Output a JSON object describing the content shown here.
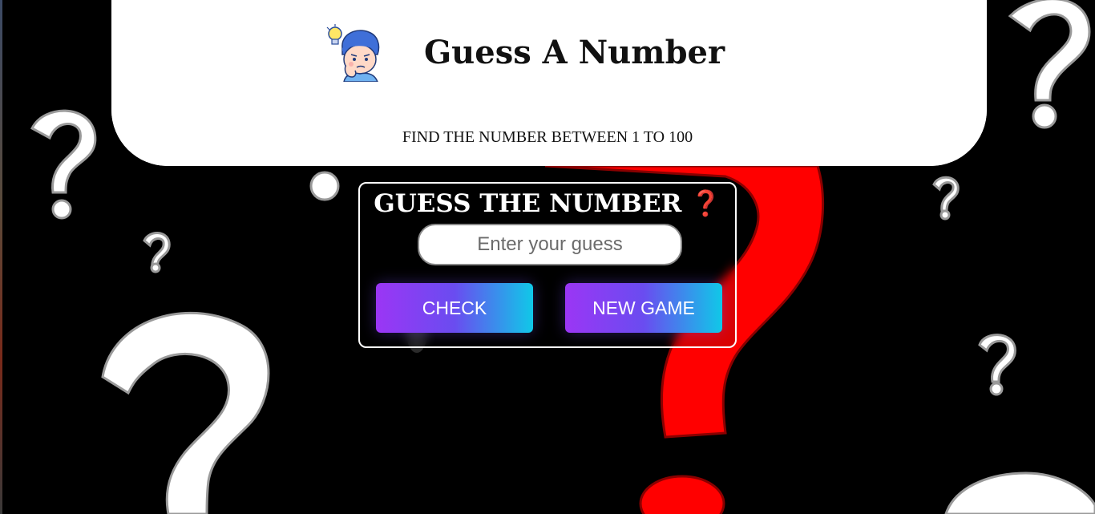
{
  "header": {
    "title": "Guess A Number",
    "subtitle": "FIND THE NUMBER BETWEEN 1 TO 100",
    "logo_icon": "thinking-boy-with-lightbulb-icon"
  },
  "game": {
    "title_part1": "GUESS THE ",
    "title_part2": "NUMBER",
    "title_icon": "red-question-mark-icon",
    "title_icon_glyph": "❓",
    "input_placeholder": "Enter your guess",
    "input_value": "",
    "check_label": "CHECK",
    "new_game_label": "NEW GAME"
  },
  "colors": {
    "background": "#000000",
    "header_bg": "#ffffff",
    "accent_red": "#e81b1b",
    "button_gradient_start": "#9b36f5",
    "button_gradient_end": "#10c8e8"
  }
}
